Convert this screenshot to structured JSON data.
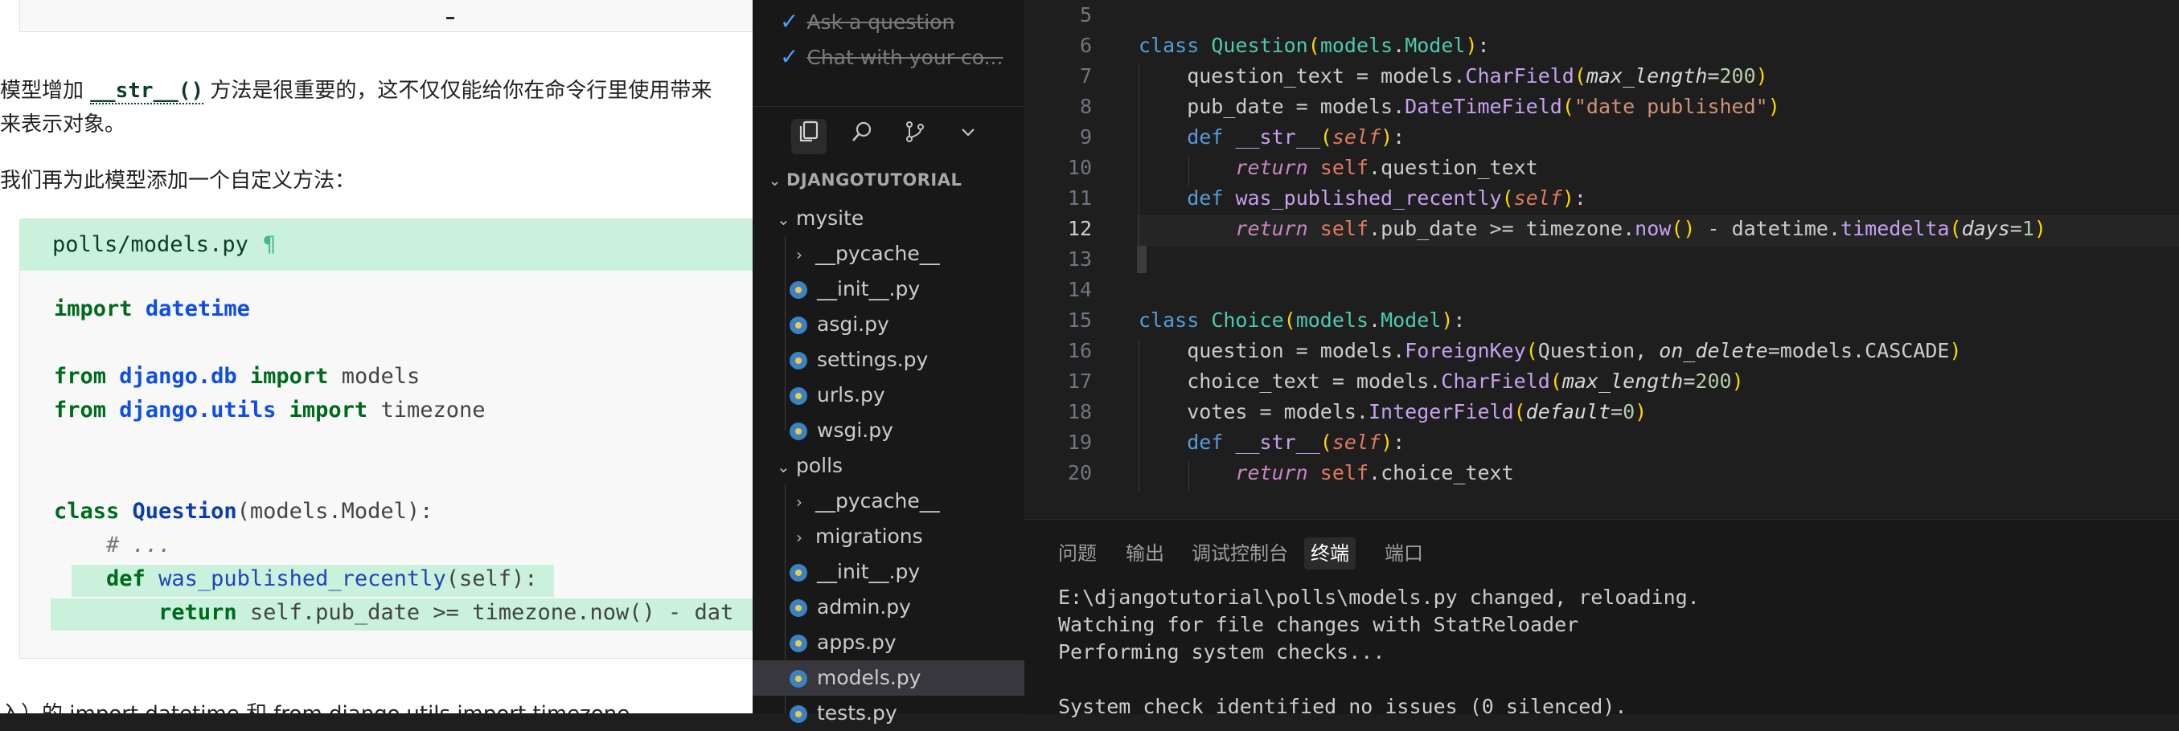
{
  "doc": {
    "para1_line1_before": "模型增加 ",
    "para1_code": "__str__()",
    "para1_line1_after": " 方法是很重要的，这不仅仅能给你在命令行里使用带来",
    "para1_line2": "来表示对象。",
    "para2": "我们再为此模型添加一个自定义方法：",
    "code_filename": "polls/models.py",
    "pilcrow": "¶",
    "code": {
      "l1_kw": "import",
      "l1_mod": "datetime",
      "l2_kw1": "from",
      "l2_mod": "django.db",
      "l2_kw2": "import",
      "l2_name": "models",
      "l3_kw1": "from",
      "l3_mod": "django.utils",
      "l3_kw2": "import",
      "l3_name": "timezone",
      "l4_kw": "class",
      "l4_cls": "Question",
      "l4_rest": "(models.Model):",
      "l5": "    # ...",
      "l6_kw": "def",
      "l6_fn": "was_published_recently",
      "l6_rest": "(self):",
      "l7_kw": "return",
      "l7_rest": " self.pub_date >= timezone.now() - dat"
    },
    "bottom_text": "入）的 import datetime 和 from django.utils import timezone"
  },
  "explorer": {
    "todos": [
      "Ask a question",
      "Chat with your co..."
    ],
    "section_title": "DJANGOTUTORIAL",
    "items": [
      {
        "label": "mysite",
        "kind": "folder-open"
      },
      {
        "label": "__pycache__",
        "kind": "folder"
      },
      {
        "label": "__init__.py",
        "kind": "py"
      },
      {
        "label": "asgi.py",
        "kind": "py"
      },
      {
        "label": "settings.py",
        "kind": "py"
      },
      {
        "label": "urls.py",
        "kind": "py"
      },
      {
        "label": "wsgi.py",
        "kind": "py"
      },
      {
        "label": "polls",
        "kind": "folder-open"
      },
      {
        "label": "__pycache__",
        "kind": "folder"
      },
      {
        "label": "migrations",
        "kind": "folder"
      },
      {
        "label": "__init__.py",
        "kind": "py"
      },
      {
        "label": "admin.py",
        "kind": "py"
      },
      {
        "label": "apps.py",
        "kind": "py"
      },
      {
        "label": "models.py",
        "kind": "py",
        "selected": true
      },
      {
        "label": "tests.py",
        "kind": "py"
      }
    ],
    "icons": [
      "explorer-icon",
      "search-icon",
      "source-control-icon",
      "chevron-down-icon"
    ]
  },
  "editor": {
    "line_numbers": [
      "5",
      "6",
      "7",
      "8",
      "9",
      "10",
      "11",
      "12",
      "13",
      "14",
      "15",
      "16",
      "17",
      "18",
      "19",
      "20"
    ],
    "current_line": "12"
  },
  "panel": {
    "tabs": [
      "问题",
      "输出",
      "调试控制台",
      "终端",
      "端口"
    ],
    "active_tab": "终端",
    "terminal_lines": [
      "E:\\djangotutorial\\polls\\models.py changed, reloading.",
      "Watching for file changes with StatReloader",
      "Performing system checks...",
      "",
      "System check identified no issues (0 silenced)."
    ]
  }
}
